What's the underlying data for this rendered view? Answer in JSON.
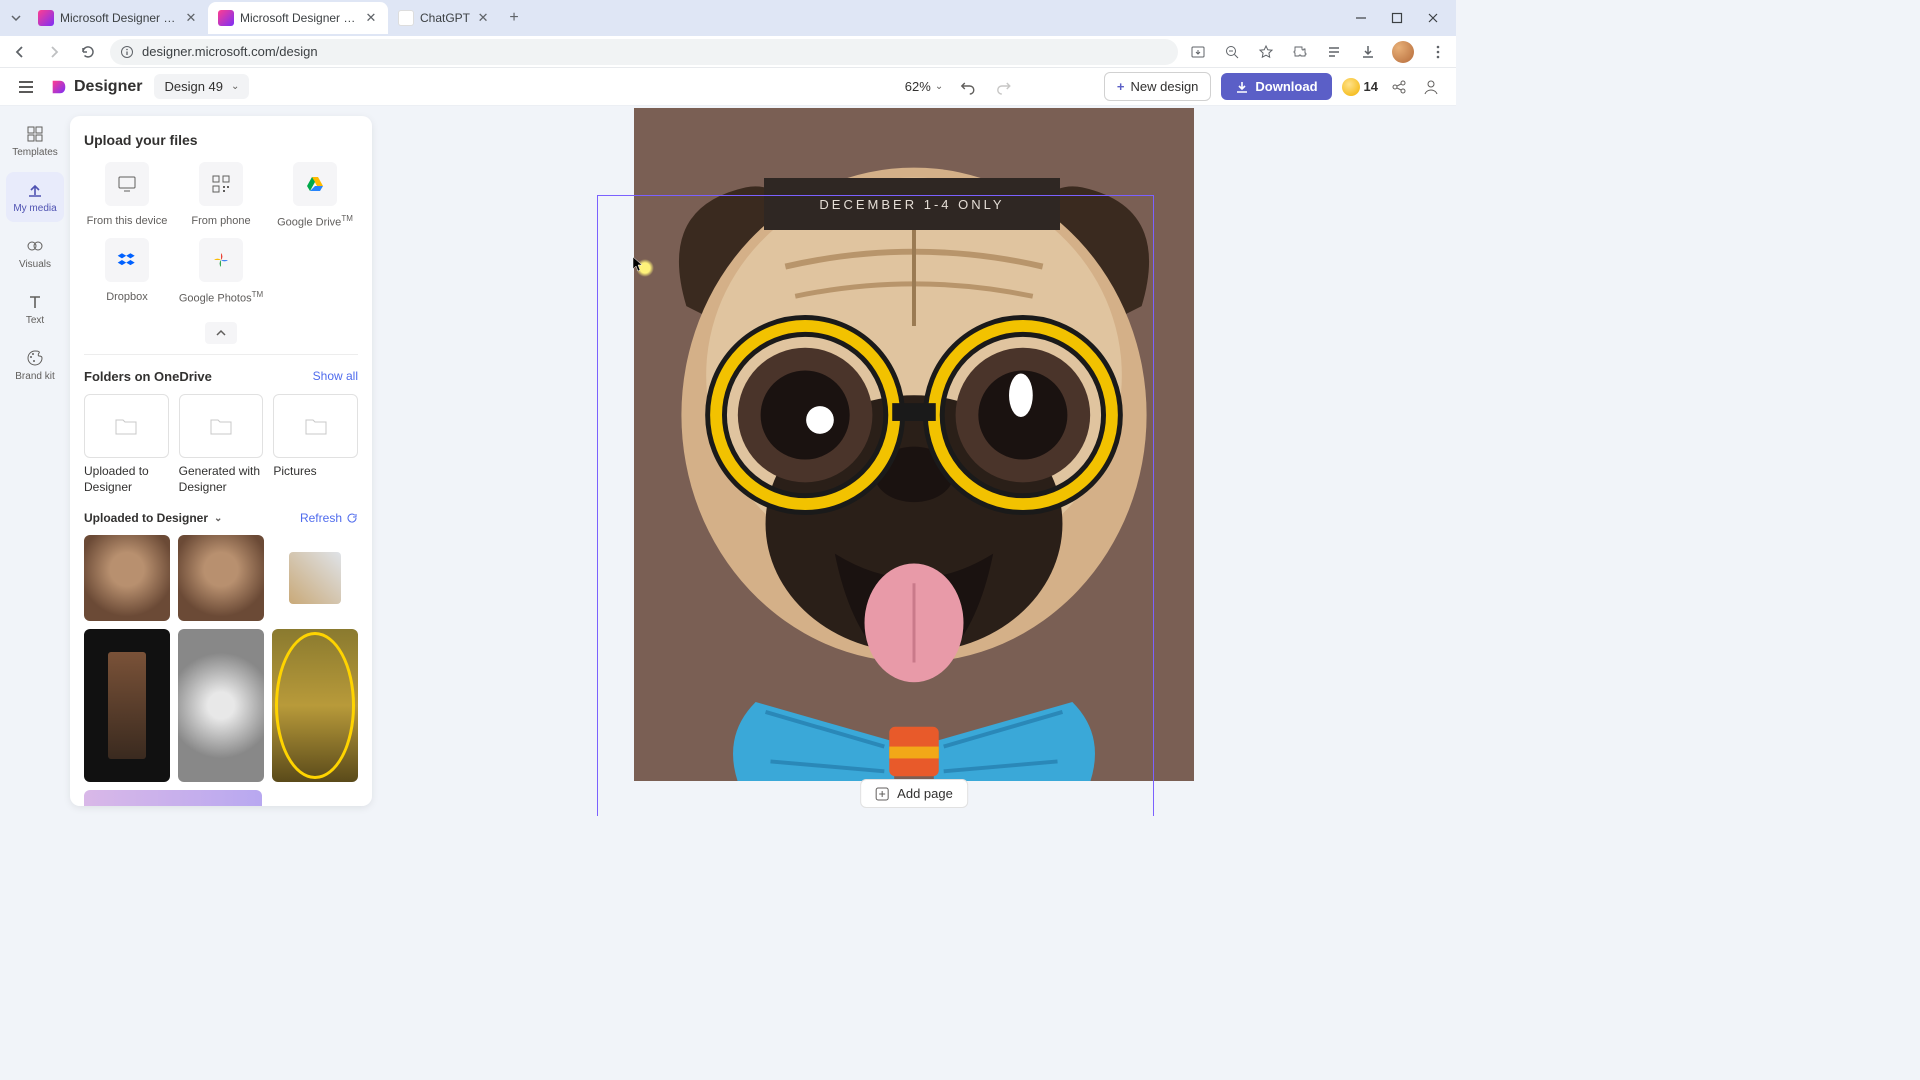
{
  "browser": {
    "tabs": [
      {
        "title": "Microsoft Designer - Stunning",
        "active": false
      },
      {
        "title": "Microsoft Designer - Stunning",
        "active": true
      },
      {
        "title": "ChatGPT",
        "active": false
      }
    ],
    "url": "designer.microsoft.com/design"
  },
  "header": {
    "app_name": "Designer",
    "doc_name": "Design 49",
    "zoom": "62%",
    "new_design": "New design",
    "download": "Download",
    "coins": "14"
  },
  "rail": {
    "templates": "Templates",
    "my_media": "My media",
    "visuals": "Visuals",
    "text": "Text",
    "brand_kit": "Brand kit"
  },
  "panel": {
    "upload_heading": "Upload your files",
    "uploads": {
      "device": "From this device",
      "phone": "From phone",
      "gdrive": "Google Drive",
      "dropbox": "Dropbox",
      "gphotos": "Google Photos"
    },
    "folders_heading": "Folders on OneDrive",
    "show_all": "Show all",
    "folders": [
      "Uploaded to Designer",
      "Generated with Designer",
      "Pictures"
    ],
    "section_dd": "Uploaded to Designer",
    "refresh": "Refresh"
  },
  "canvas": {
    "banner_text": "DECEMBER 1-4 ONLY",
    "add_page": "Add page"
  }
}
